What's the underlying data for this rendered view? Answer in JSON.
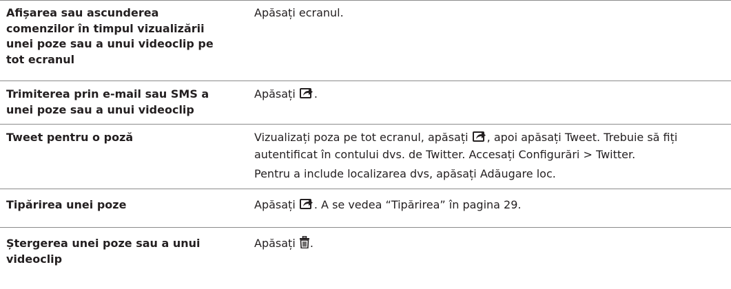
{
  "rows": [
    {
      "label": "Afișarea sau ascunderea comenzilor în timpul vizualizării unei poze sau a unui videoclip pe tot ecranul",
      "desc": [
        {
          "pre": "Apăsați ecranul."
        }
      ]
    },
    {
      "label": "Trimiterea prin e-mail sau SMS a unei poze sau a unui videoclip",
      "desc": [
        {
          "pre": "Apăsați ",
          "icon": "share-icon",
          "post": "."
        }
      ]
    },
    {
      "label": "Tweet pentru o poză",
      "desc": [
        {
          "pre": "Vizualizați poza pe tot ecranul, apăsați ",
          "icon": "share-icon",
          "post": ", apoi apăsați Tweet. Trebuie să fiți autentificat în contului dvs. de Twitter. Accesați Configurări > Twitter."
        },
        {
          "pre": "Pentru a include localizarea dvs, apăsați Adăugare loc."
        }
      ]
    },
    {
      "label": "Tipărirea unei poze",
      "desc": [
        {
          "pre": "Apăsați ",
          "icon": "share-icon",
          "post": ". A se vedea “Tipărirea” în pagina 29."
        }
      ]
    },
    {
      "label": "Ștergerea unei poze sau a unui videoclip",
      "desc": [
        {
          "pre": "Apăsați ",
          "icon": "trash-icon",
          "post": "."
        }
      ]
    }
  ]
}
